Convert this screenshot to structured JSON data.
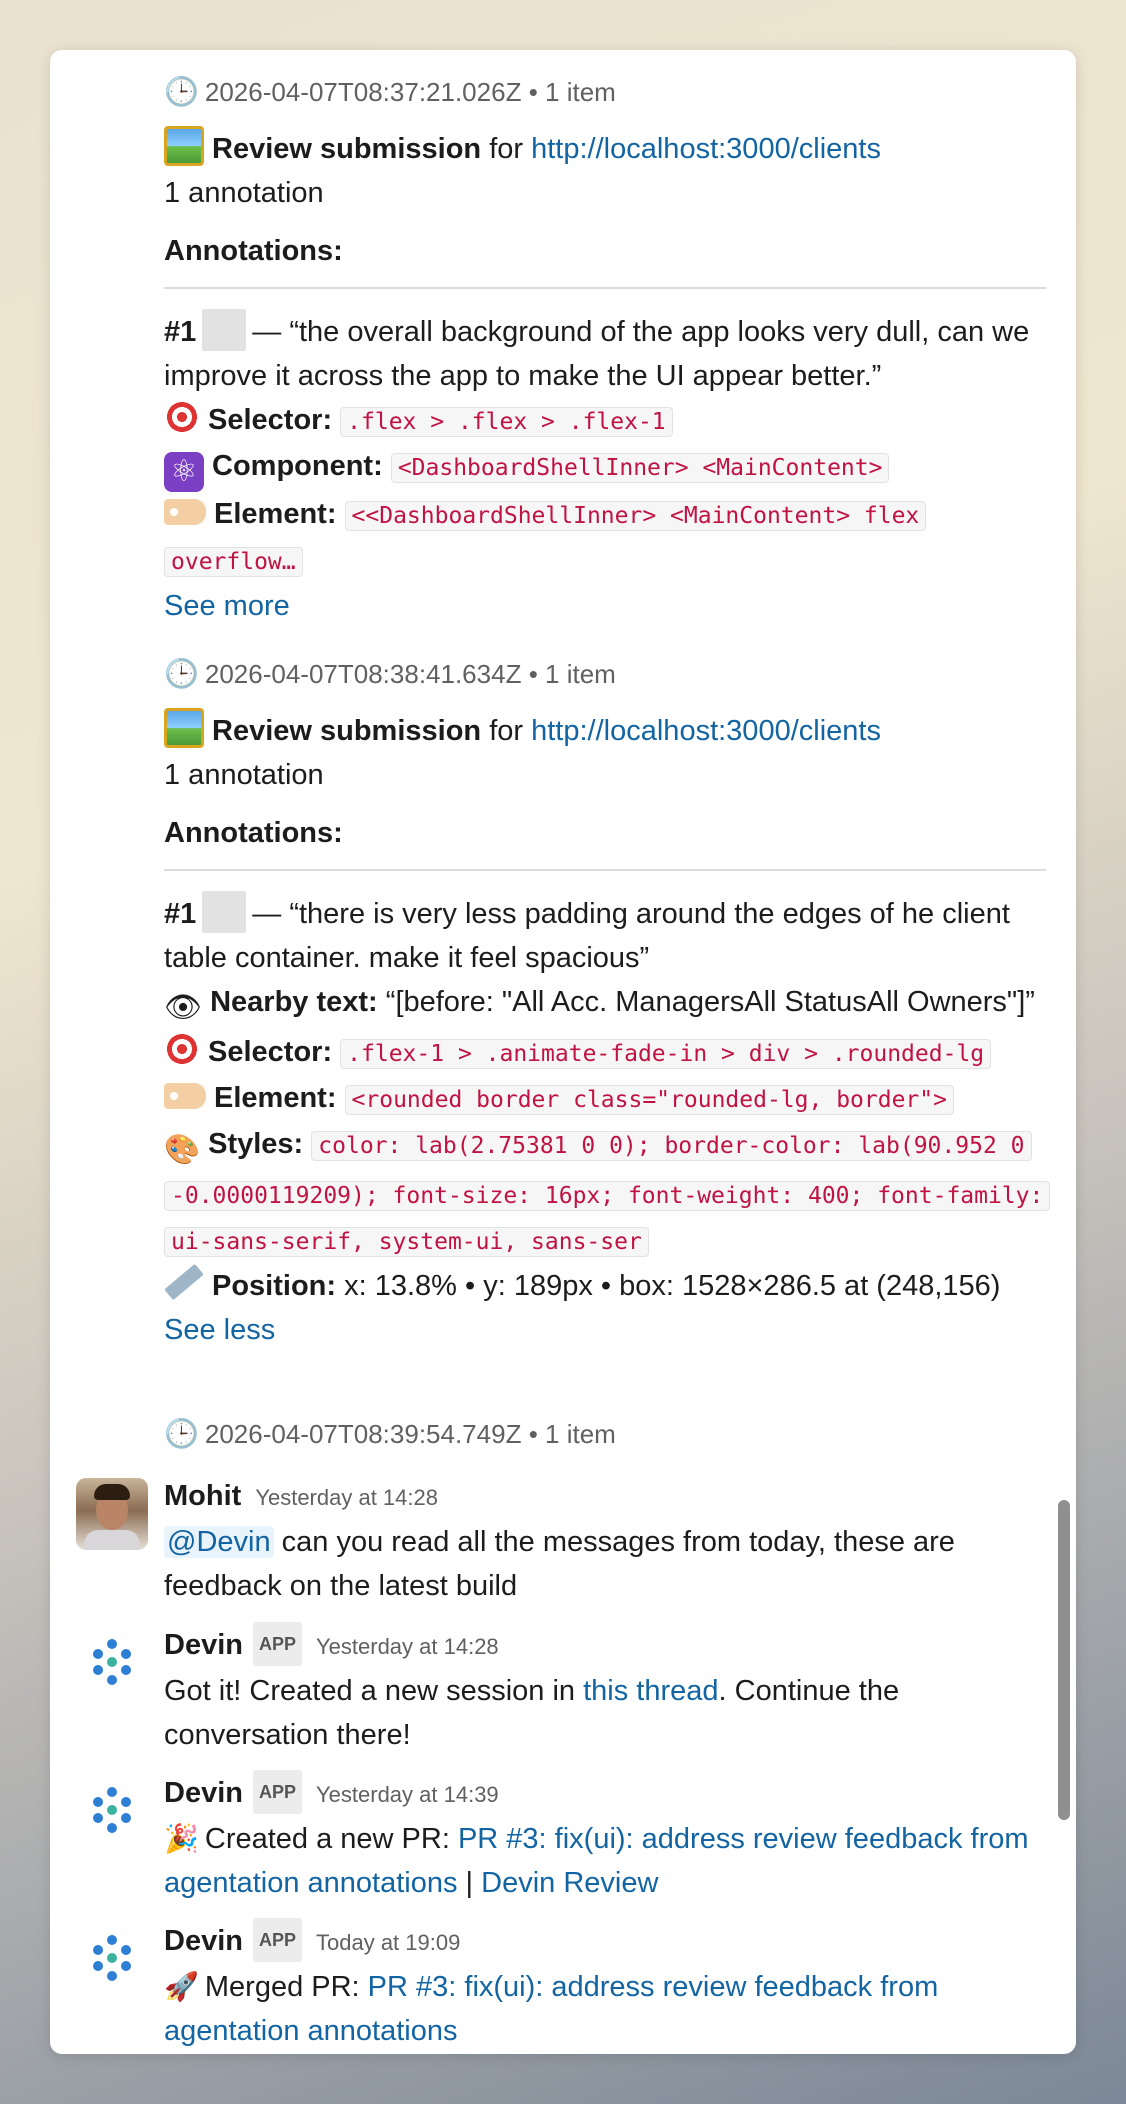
{
  "blocks": {
    "b1": {
      "timestamp": "2026-04-07T08:37:21.026Z",
      "items": "• 1 item",
      "review_label": "Review submission",
      "for": "for",
      "url": "http://localhost:3000/clients",
      "annotation_count": "1 annotation",
      "annotations_heading": "Annotations:",
      "num": "#1",
      "quote": "— “the overall background of the app looks very dull, can we improve it across the app to make the UI appear better.”",
      "selector_label": "Selector:",
      "selector_value": ".flex > .flex > .flex-1",
      "component_label": "Component:",
      "component_value": "<DashboardShellInner> <MainContent>",
      "element_label": "Element:",
      "element_value": "<<DashboardShellInner> <MainContent> flex overflow…",
      "toggle": "See more"
    },
    "b2": {
      "timestamp": "2026-04-07T08:38:41.634Z",
      "items": "• 1 item",
      "review_label": "Review submission",
      "for": "for",
      "url": "http://localhost:3000/clients",
      "annotation_count": "1 annotation",
      "annotations_heading": "Annotations:",
      "num": "#1",
      "quote": "— “there is very less padding around the edges of he client table container. make it feel spacious”",
      "nearby_label": "Nearby text:",
      "nearby_value": "“[before: \"All Acc. ManagersAll StatusAll Owners\"]”",
      "selector_label": "Selector:",
      "selector_value": ".flex-1 > .animate-fade-in > div > .rounded-lg",
      "element_label": "Element:",
      "element_value": "<rounded border class=\"rounded-lg, border\">",
      "styles_label": "Styles:",
      "styles_value": "color: lab(2.75381 0 0); border-color: lab(90.952 0 -0.0000119209); font-size: 16px; font-weight: 400; font-family: ui-sans-serif, system-ui, sans-ser",
      "position_label": "Position:",
      "position_value": "x: 13.8% • y: 189px • box: 1528×286.5 at (248,156)",
      "toggle": "See less"
    },
    "b3": {
      "timestamp": "2026-04-07T08:39:54.749Z",
      "items": "• 1 item"
    }
  },
  "messages": [
    {
      "author": "Mohit",
      "time": "Yesterday at 14:28",
      "mention": "@Devin",
      "text": " can you read all the messages from today, these are feedback on the latest build"
    },
    {
      "author": "Devin",
      "app_tag": "APP",
      "time": "Yesterday at 14:28",
      "text_before": "Got it! Created a new session in ",
      "link": "this thread",
      "text_after": ". Continue the conversation there!"
    },
    {
      "author": "Devin",
      "app_tag": "APP",
      "time": "Yesterday at 14:39",
      "text_before": "Created a new PR: ",
      "link": "PR #3: fix(ui): address review feedback from agentation annotations",
      "sep": " | ",
      "link2": "Devin Review"
    },
    {
      "author": "Devin",
      "app_tag": "APP",
      "time": "Today at 19:09",
      "text_before": "Merged PR: ",
      "link": "PR #3: fix(ui): address review feedback from agentation annotations"
    }
  ],
  "icons": {
    "clock": "clock-icon",
    "picture": "framed-picture-icon",
    "target": "target-icon",
    "react": "atom-icon",
    "tag": "label-tag-icon",
    "eye": "eye-icon",
    "palette": "palette-icon",
    "ruler": "ruler-icon",
    "party": "party-popper-icon",
    "rocket": "rocket-icon"
  },
  "colors": {
    "link": "#1264a3",
    "code": "#c01343",
    "mention_bg": "#e8f3fb"
  }
}
